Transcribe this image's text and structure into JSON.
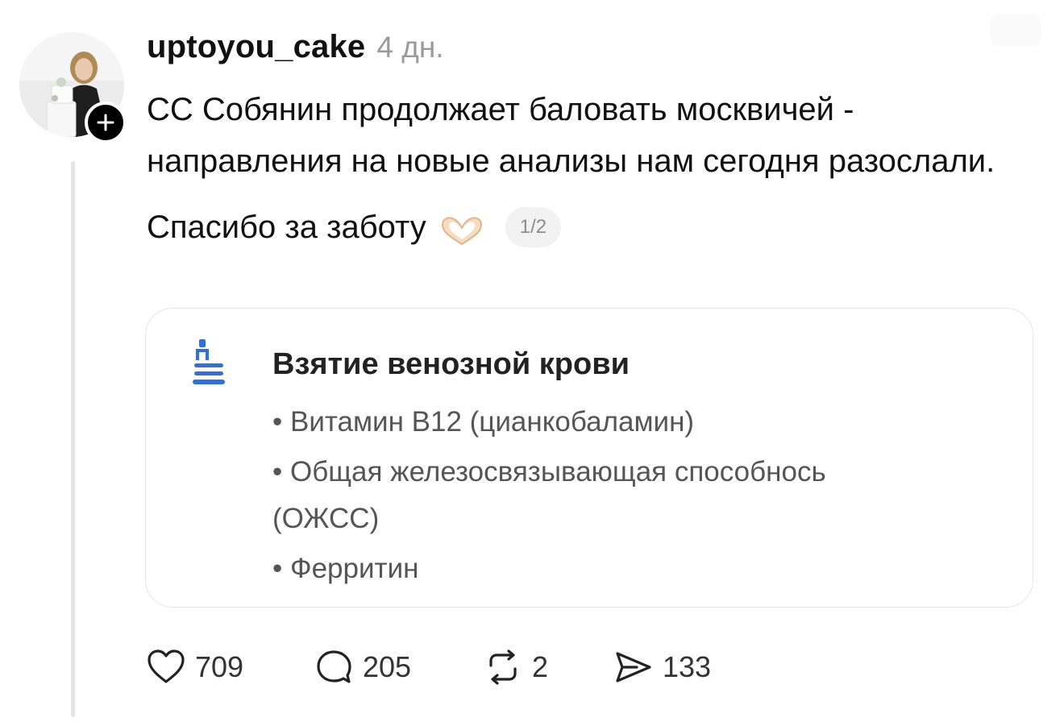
{
  "post": {
    "username": "uptoyou_cake",
    "time": "4 дн.",
    "text_paragraph_1": "СС Собянин продолжает баловать москвичей - направления на новые анализы нам сегодня разослали.",
    "text_paragraph_2": "Спасибо за заботу",
    "emoji": "heart-hands",
    "page_indicator": "1/2"
  },
  "attachment": {
    "icon": "lab-test-icon",
    "title": "Взятие венозной крови",
    "items": [
      "• Витамин B12 (цианкобаламин)",
      "• Общая железосвязывающая способнось (ОЖСС)",
      "• Ферритин"
    ]
  },
  "actions": {
    "likes": "709",
    "replies": "205",
    "reposts": "2",
    "shares": "133"
  },
  "colors": {
    "accent_blue": "#2f6fe0",
    "muted_text": "#9a9a9a",
    "divider": "#e5e5e5"
  }
}
